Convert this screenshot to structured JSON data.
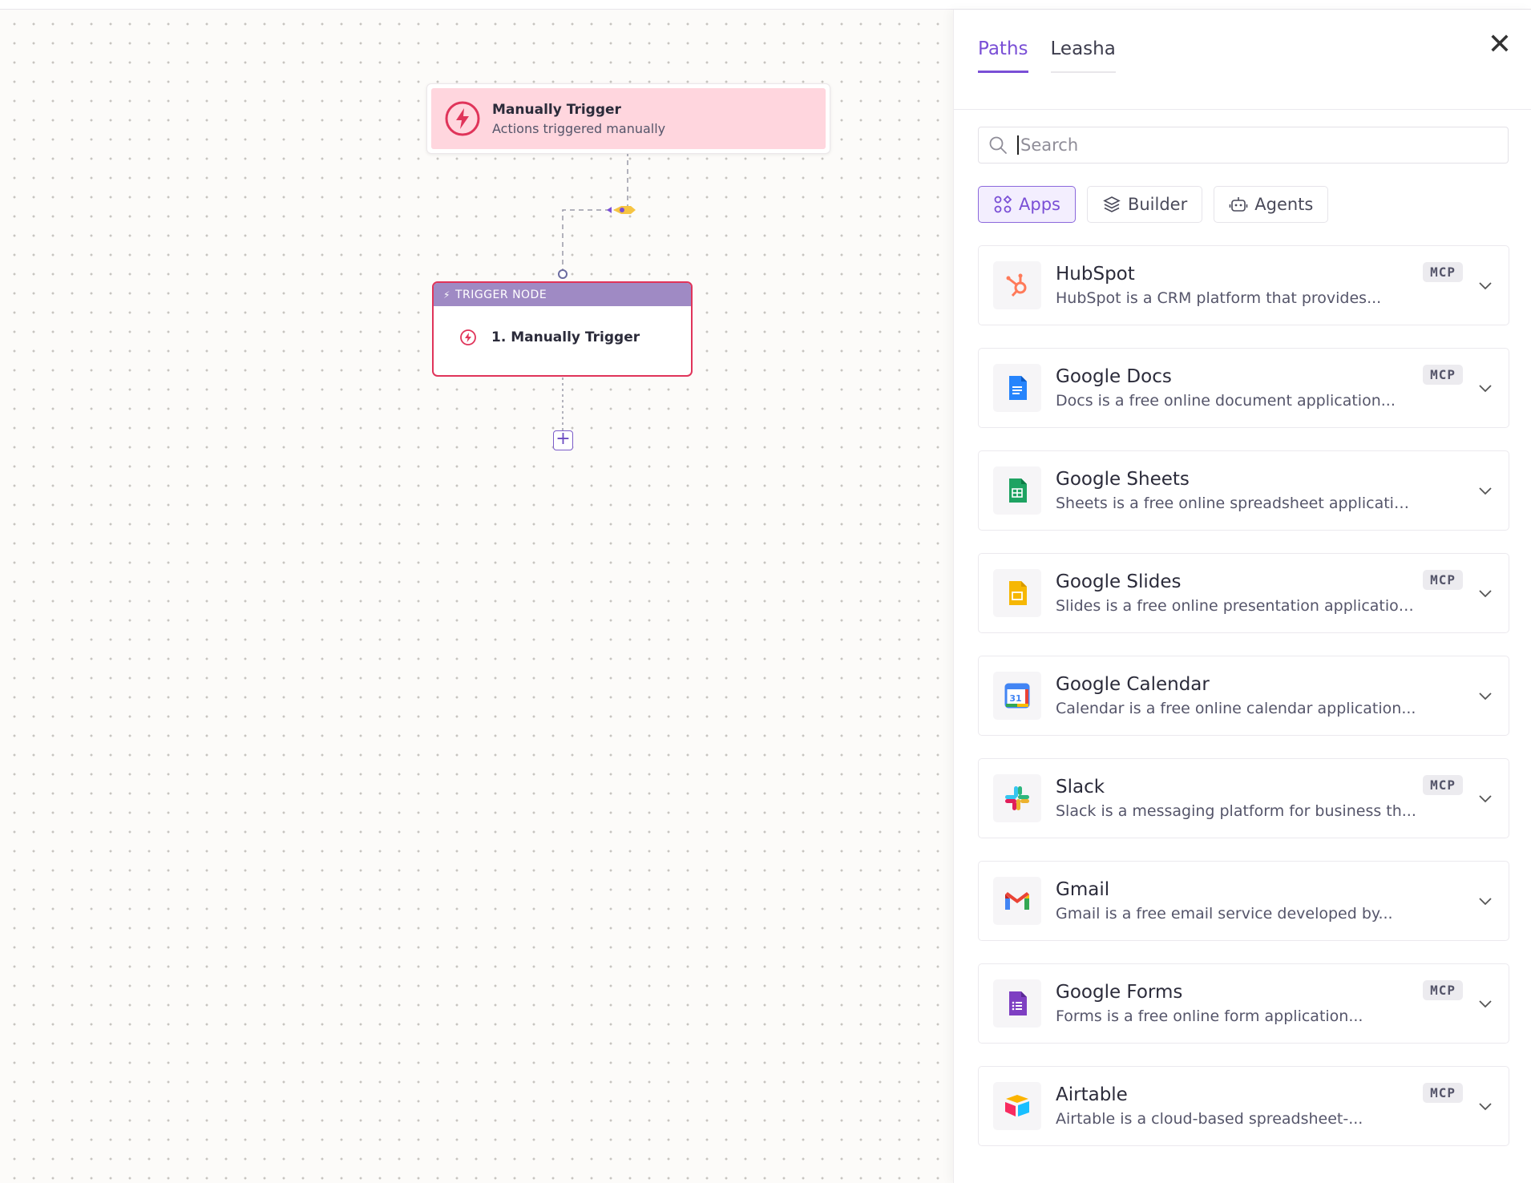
{
  "canvas": {
    "manual_trigger": {
      "title": "Manually Trigger",
      "subtitle": "Actions triggered manually"
    },
    "trigger_node": {
      "header": "TRIGGER NODE",
      "step": "1. Manually Trigger"
    },
    "add_step": "+"
  },
  "panel": {
    "tabs": [
      {
        "label": "Paths",
        "active": true
      },
      {
        "label": "Leasha",
        "active": false
      }
    ],
    "close": "✕",
    "search": {
      "placeholder": "Search",
      "value": ""
    },
    "filters": [
      {
        "label": "Apps",
        "icon": "apps-icon",
        "active": true
      },
      {
        "label": "Builder",
        "icon": "builder-icon",
        "active": false
      },
      {
        "label": "Agents",
        "icon": "robot-icon",
        "active": false
      }
    ],
    "badge": "MCP",
    "apps": [
      {
        "name": "HubSpot",
        "desc": "HubSpot is a CRM platform that provides...",
        "mcp": true,
        "icon": "hubspot-icon"
      },
      {
        "name": "Google Docs",
        "desc": "Docs is a free online document application...",
        "mcp": true,
        "icon": "google-docs-icon"
      },
      {
        "name": "Google Sheets",
        "desc": "Sheets is a free online spreadsheet applicatio...",
        "mcp": false,
        "icon": "google-sheets-icon"
      },
      {
        "name": "Google Slides",
        "desc": "Slides is a free online presentation application...",
        "mcp": true,
        "icon": "google-slides-icon"
      },
      {
        "name": "Google Calendar",
        "desc": "Calendar is a free online calendar application...",
        "mcp": false,
        "icon": "google-calendar-icon"
      },
      {
        "name": "Slack",
        "desc": "Slack is a messaging platform for business th...",
        "mcp": true,
        "icon": "slack-icon"
      },
      {
        "name": "Gmail",
        "desc": "Gmail is a free email service developed by...",
        "mcp": false,
        "icon": "gmail-icon"
      },
      {
        "name": "Google Forms",
        "desc": "Forms is a free online form application...",
        "mcp": true,
        "icon": "google-forms-icon"
      },
      {
        "name": "Airtable",
        "desc": "Airtable is a cloud-based spreadsheet-...",
        "mcp": true,
        "icon": "airtable-icon"
      }
    ],
    "calendar_day": "31"
  },
  "colors": {
    "accent": "#7a4fd6",
    "trigger_red": "#e0345a",
    "trigger_pink": "#ffd6de",
    "node_header": "#9f8ac4"
  }
}
